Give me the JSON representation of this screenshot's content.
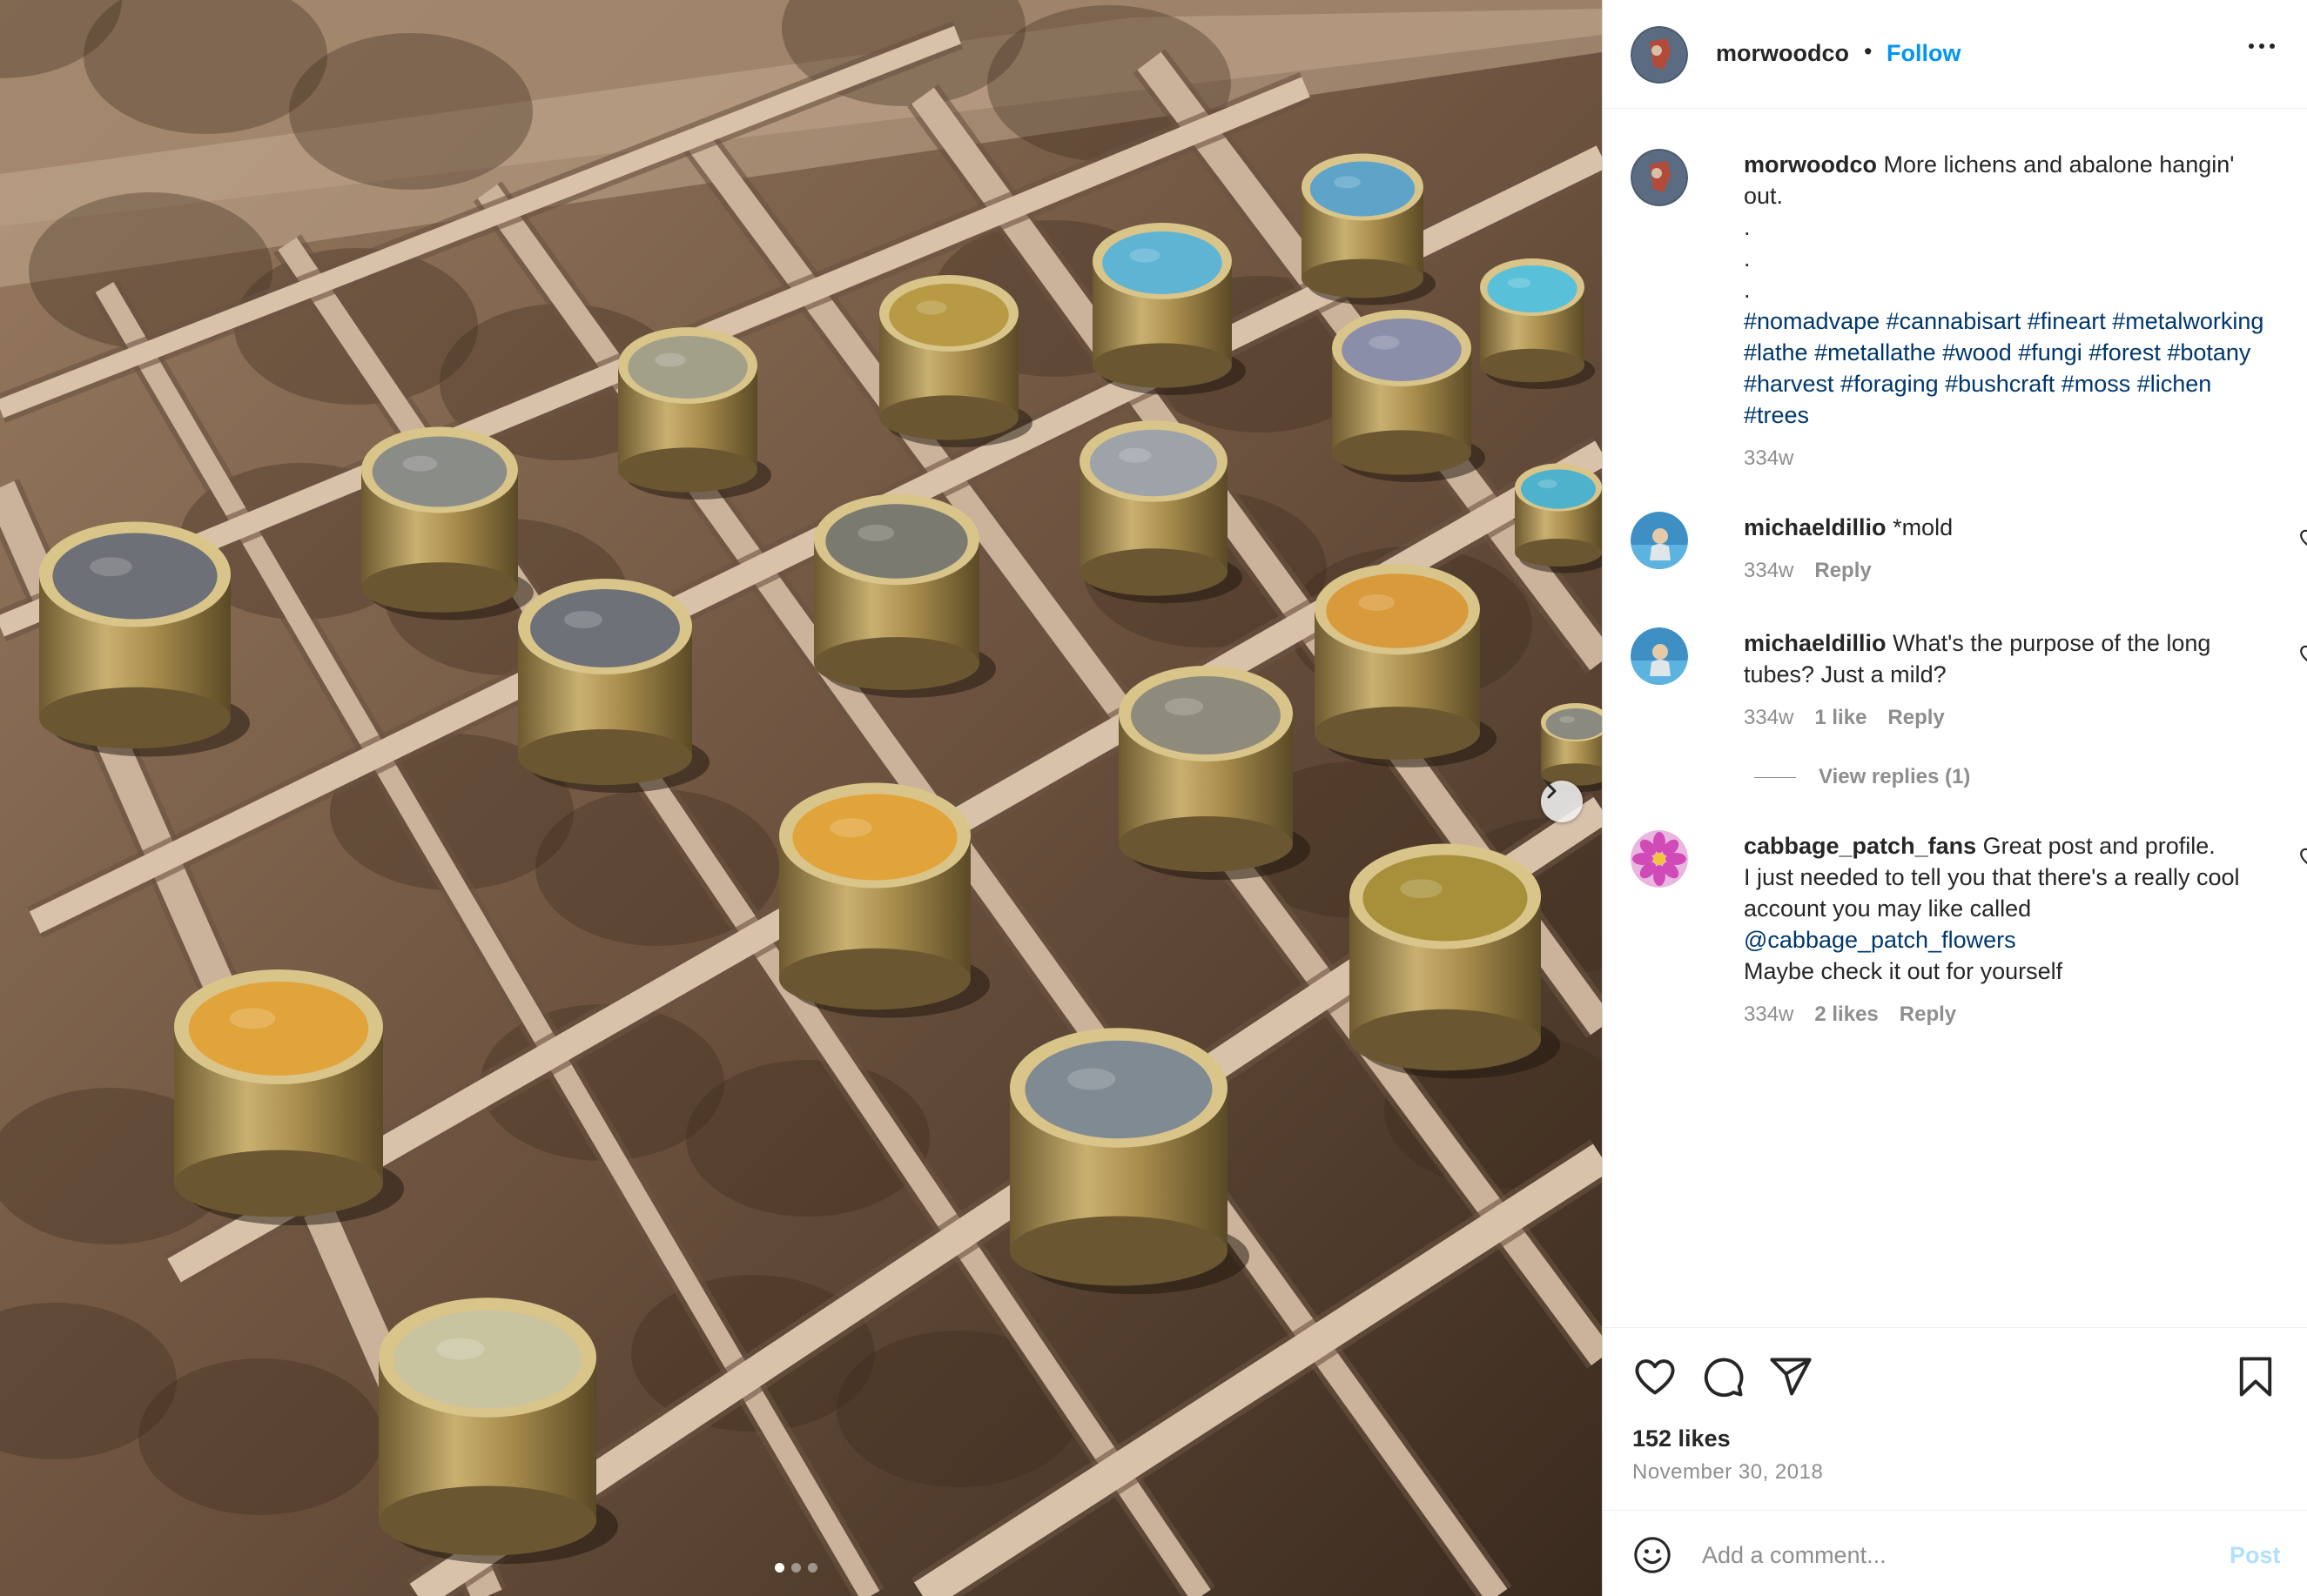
{
  "post": {
    "author": "morwoodco",
    "follow_label": "Follow",
    "separator": "•",
    "more_icon": "more-horizontal-icon"
  },
  "photo": {
    "carousel_pages": 3,
    "active_page": 1,
    "next_icon": "chevron-right-icon"
  },
  "caption": {
    "username": "morwoodco",
    "text": "More lichens and abalone hangin' out.",
    "dots": [
      ".",
      ".",
      "."
    ],
    "hashtags": "#nomadvape #cannabisart #fineart #metalworking #lathe #metallathe #wood #fungi #forest #botany #harvest #foraging #bushcraft #moss #lichen #trees",
    "time": "334w"
  },
  "comments": [
    {
      "username": "michaeldillio",
      "text": "*mold",
      "time": "334w",
      "likes": "",
      "reply_label": "Reply"
    },
    {
      "username": "michaeldillio",
      "text": "What's the purpose of the long tubes? Just a mild?",
      "time": "334w",
      "likes": "1 like",
      "reply_label": "Reply",
      "view_replies": "View replies (1)"
    },
    {
      "username": "cabbage_patch_fans",
      "text": "Great post and profile.",
      "text_line2": "I just needed to tell you that there's a really cool account you may like called",
      "mention": "@cabbage_patch_flowers",
      "text_line3": "Maybe check it out for yourself",
      "time": "334w",
      "likes": "2 likes",
      "reply_label": "Reply"
    }
  ],
  "actions": {
    "like_icon": "heart-icon",
    "comment_icon": "comment-icon",
    "share_icon": "share-icon",
    "save_icon": "bookmark-icon",
    "likes": "152 likes",
    "date": "November 30, 2018"
  },
  "add_comment": {
    "placeholder": "Add a comment...",
    "post_label": "Post",
    "emoji_icon": "emoji-icon"
  },
  "colors": {
    "link_blue": "#0095f6",
    "hashtag": "#00376b",
    "secondary_text": "#8e8e8e",
    "post_disabled": "#b2dffc"
  }
}
